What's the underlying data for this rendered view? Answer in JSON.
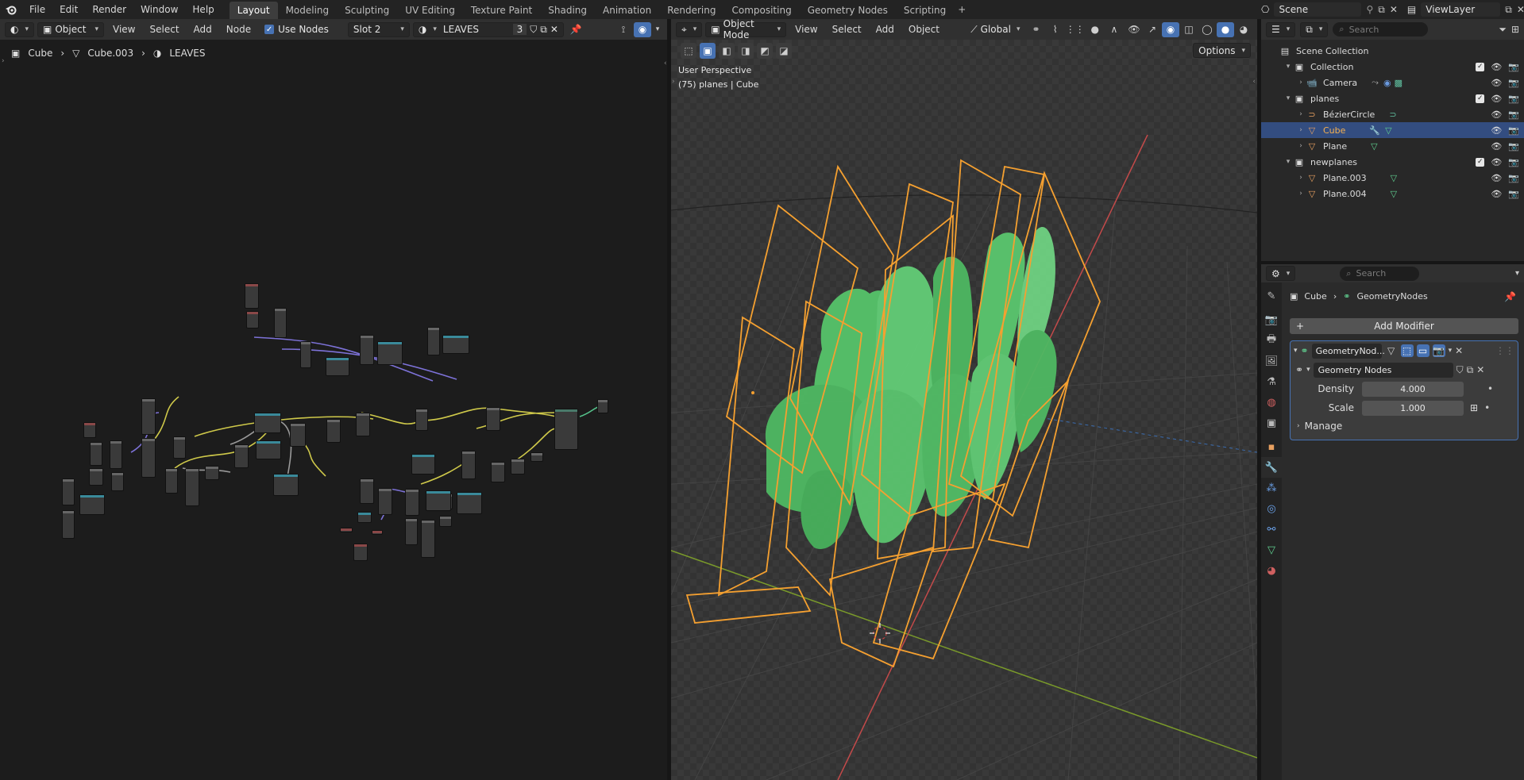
{
  "menus": [
    "File",
    "Edit",
    "Render",
    "Window",
    "Help"
  ],
  "workspaces": [
    "Layout",
    "Modeling",
    "Sculpting",
    "UV Editing",
    "Texture Paint",
    "Shading",
    "Animation",
    "Rendering",
    "Compositing",
    "Geometry Nodes",
    "Scripting"
  ],
  "active_workspace": "Layout",
  "scene": "Scene",
  "view_layer": "ViewLayer",
  "node_editor": {
    "object_mode": "Object",
    "view": "View",
    "select": "Select",
    "add": "Add",
    "node": "Node",
    "use_nodes": "Use Nodes",
    "slot": "Slot 2",
    "material": "LEAVES",
    "users": "3",
    "breadcrumb": {
      "object": "Cube",
      "mesh": "Cube.003",
      "material": "LEAVES"
    }
  },
  "viewport": {
    "mode": "Object Mode",
    "view": "View",
    "select": "Select",
    "add": "Add",
    "object": "Object",
    "transform": "Global",
    "options": "Options",
    "perspective": "User Perspective",
    "info": "(75) planes | Cube"
  },
  "outliner": {
    "search_placeholder": "Search",
    "root": "Scene Collection",
    "collection": "Collection",
    "camera": "Camera",
    "planes": "planes",
    "bezier": "BézierCircle",
    "cube": "Cube",
    "plane": "Plane",
    "newplanes": "newplanes",
    "plane003": "Plane.003",
    "plane004": "Plane.004"
  },
  "properties": {
    "search_placeholder": "Search",
    "object": "Cube",
    "modifier_path": "GeometryNodes",
    "add_modifier": "Add Modifier",
    "modifier_name": "GeometryNod...",
    "node_group": "Geometry Nodes",
    "density_label": "Density",
    "density": "4.000",
    "scale_label": "Scale",
    "scale": "1.000",
    "manage": "Manage"
  },
  "colors": {
    "accent": "#4772b3",
    "selection_orange": "#f5a030",
    "leaves_green": "#56c46a",
    "axis_x": "#c34a4a",
    "axis_y": "#7a9a2a"
  }
}
